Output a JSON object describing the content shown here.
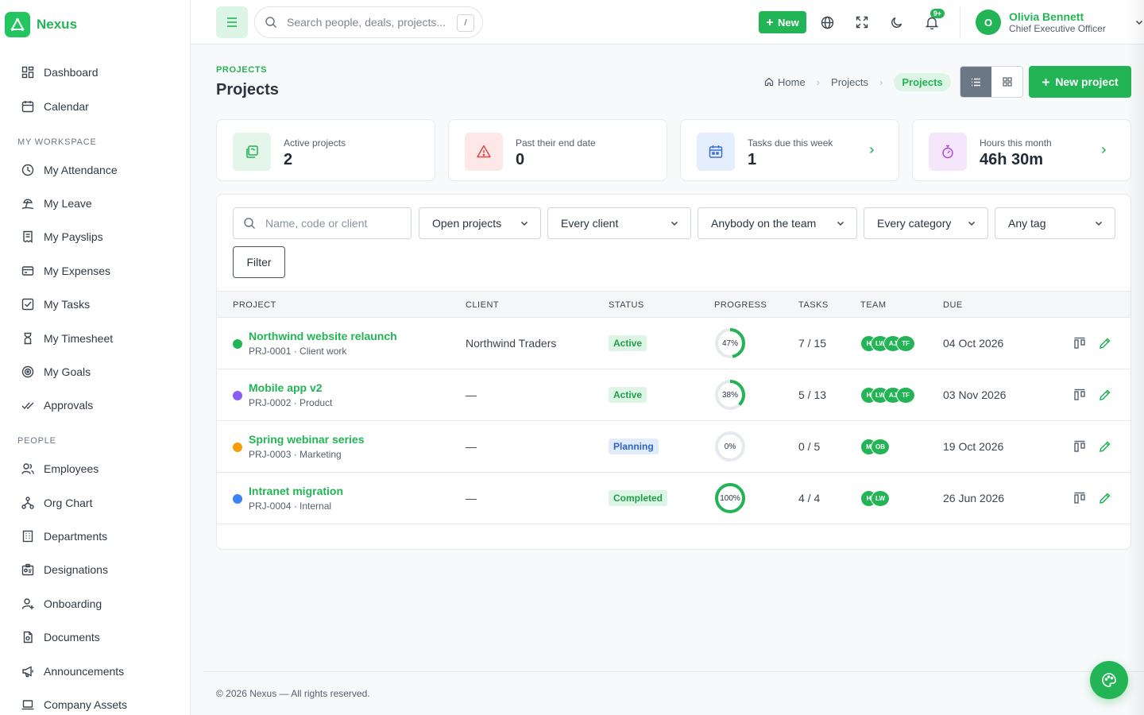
{
  "brand": {
    "name": "Nexus",
    "accent": "#22b455"
  },
  "sidebar": {
    "top_items": [
      {
        "label": "Dashboard",
        "icon": "dashboard-icon"
      },
      {
        "label": "Calendar",
        "icon": "calendar-icon"
      }
    ],
    "workspace_title": "MY WORKSPACE",
    "workspace_items": [
      {
        "label": "My Attendance",
        "icon": "clock-icon"
      },
      {
        "label": "My Leave",
        "icon": "beach-icon"
      },
      {
        "label": "My Payslips",
        "icon": "receipt-icon"
      },
      {
        "label": "My Expenses",
        "icon": "credit-card-icon"
      },
      {
        "label": "My Tasks",
        "icon": "checkbox-icon"
      },
      {
        "label": "My Timesheet",
        "icon": "hourglass-icon"
      },
      {
        "label": "My Goals",
        "icon": "target-icon"
      },
      {
        "label": "Approvals",
        "icon": "double-check-icon"
      }
    ],
    "people_title": "PEOPLE",
    "people_items": [
      {
        "label": "Employees",
        "icon": "users-icon"
      },
      {
        "label": "Org Chart",
        "icon": "hierarchy-icon"
      },
      {
        "label": "Departments",
        "icon": "building-icon"
      },
      {
        "label": "Designations",
        "icon": "id-badge-icon"
      },
      {
        "label": "Onboarding",
        "icon": "user-plus-icon"
      },
      {
        "label": "Documents",
        "icon": "document-icon"
      },
      {
        "label": "Announcements",
        "icon": "megaphone-icon"
      },
      {
        "label": "Company Assets",
        "icon": "laptop-icon"
      }
    ]
  },
  "topbar": {
    "search_placeholder": "Search people, deals, projects...",
    "search_shortcut": "/",
    "new_label": "New",
    "notification_badge": "9+",
    "user": {
      "initial": "O",
      "name": "Olivia Bennett",
      "role": "Chief Executive Officer"
    }
  },
  "page": {
    "eyebrow": "PROJECTS",
    "title": "Projects",
    "breadcrumb": {
      "home": "Home",
      "parent": "Projects",
      "current": "Projects"
    },
    "new_project_label": "New project"
  },
  "stats": [
    {
      "label": "Active projects",
      "value": "2",
      "icon": "folders-icon",
      "bg": "#e3f6e9",
      "color": "#22b455"
    },
    {
      "label": "Past their end date",
      "value": "0",
      "icon": "warning-icon",
      "bg": "#fde7e7",
      "color": "#e04848"
    },
    {
      "label": "Tasks due this week",
      "value": "1",
      "icon": "calendar-icon",
      "bg": "#e4eefc",
      "color": "#3b6fd6"
    },
    {
      "label": "Hours this month",
      "value": "46h 30m",
      "icon": "stopwatch-icon",
      "bg": "#f6e6fb",
      "color": "#b44bd6"
    }
  ],
  "filters": {
    "search_placeholder": "Name, code or client",
    "status": "Open projects",
    "client": "Every client",
    "team": "Anybody on the team",
    "category": "Every category",
    "tag": "Any tag",
    "filter_label": "Filter"
  },
  "table": {
    "columns": [
      "PROJECT",
      "CLIENT",
      "STATUS",
      "PROGRESS",
      "TASKS",
      "TEAM",
      "DUE"
    ],
    "rows": [
      {
        "name": "Northwind website relaunch",
        "meta": "PRJ-0001 · Client work",
        "dot": "#22b455",
        "client": "Northwind Traders",
        "status": "Active",
        "status_bg": "#dcf5e4",
        "status_color": "#1f9e4a",
        "progress": 47,
        "progress_label": "47%",
        "tasks": "7 / 15",
        "team": [
          "H",
          "LW",
          "AJ",
          "TF"
        ],
        "due": "04 Oct 2026"
      },
      {
        "name": "Mobile app v2",
        "meta": "PRJ-0002 · Product",
        "dot": "#8b5cf6",
        "client": "—",
        "status": "Active",
        "status_bg": "#dcf5e4",
        "status_color": "#1f9e4a",
        "progress": 38,
        "progress_label": "38%",
        "tasks": "5 / 13",
        "team": [
          "H",
          "LW",
          "AJ",
          "TF"
        ],
        "due": "03 Nov 2026"
      },
      {
        "name": "Spring webinar series",
        "meta": "PRJ-0003 · Marketing",
        "dot": "#f59e0b",
        "client": "—",
        "status": "Planning",
        "status_bg": "#e1ecfb",
        "status_color": "#2f64c4",
        "progress": 0,
        "progress_label": "0%",
        "tasks": "0 / 5",
        "team": [
          "M",
          "OB"
        ],
        "due": "19 Oct 2026"
      },
      {
        "name": "Intranet migration",
        "meta": "PRJ-0004 · Internal",
        "dot": "#3b82f6",
        "client": "—",
        "status": "Completed",
        "status_bg": "#dcf5e4",
        "status_color": "#1f9e4a",
        "progress": 100,
        "progress_label": "100%",
        "tasks": "4 / 4",
        "team": [
          "H",
          "LW"
        ],
        "due": "26 Jun 2026"
      }
    ]
  },
  "footer": {
    "text": "© 2026 Nexus — All rights reserved."
  }
}
